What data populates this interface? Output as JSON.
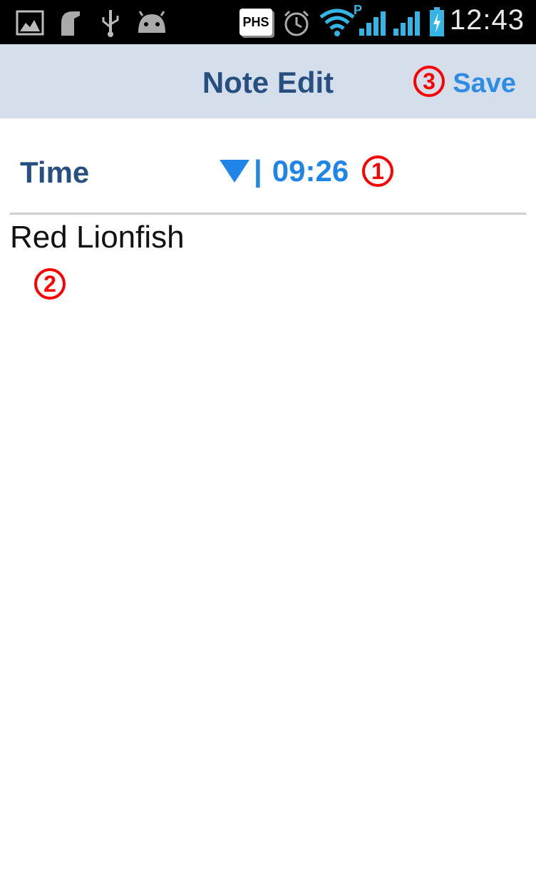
{
  "status_bar": {
    "icons": [
      "gallery-icon",
      "notification-icon",
      "usb-icon",
      "android-icon",
      "phs-icon",
      "alarm-icon",
      "wifi-icon",
      "signal-icon",
      "signal-icon",
      "battery-charging-icon"
    ],
    "phs_label": "PHS",
    "wifi_badge": "P",
    "time": "12:43"
  },
  "action_bar": {
    "title": "Note Edit",
    "save_label": "Save",
    "save_callout": "3"
  },
  "time_row": {
    "label": "Time",
    "separator": "|",
    "value": "09:26",
    "callout": "1"
  },
  "note": {
    "text": "Red Lionfish",
    "callout": "2"
  },
  "colors": {
    "status_bar_bg": "#000000",
    "action_bar_bg": "#d5dfec",
    "title": "#274f7f",
    "accent": "#1f86e8",
    "callout": "#ff0000"
  }
}
